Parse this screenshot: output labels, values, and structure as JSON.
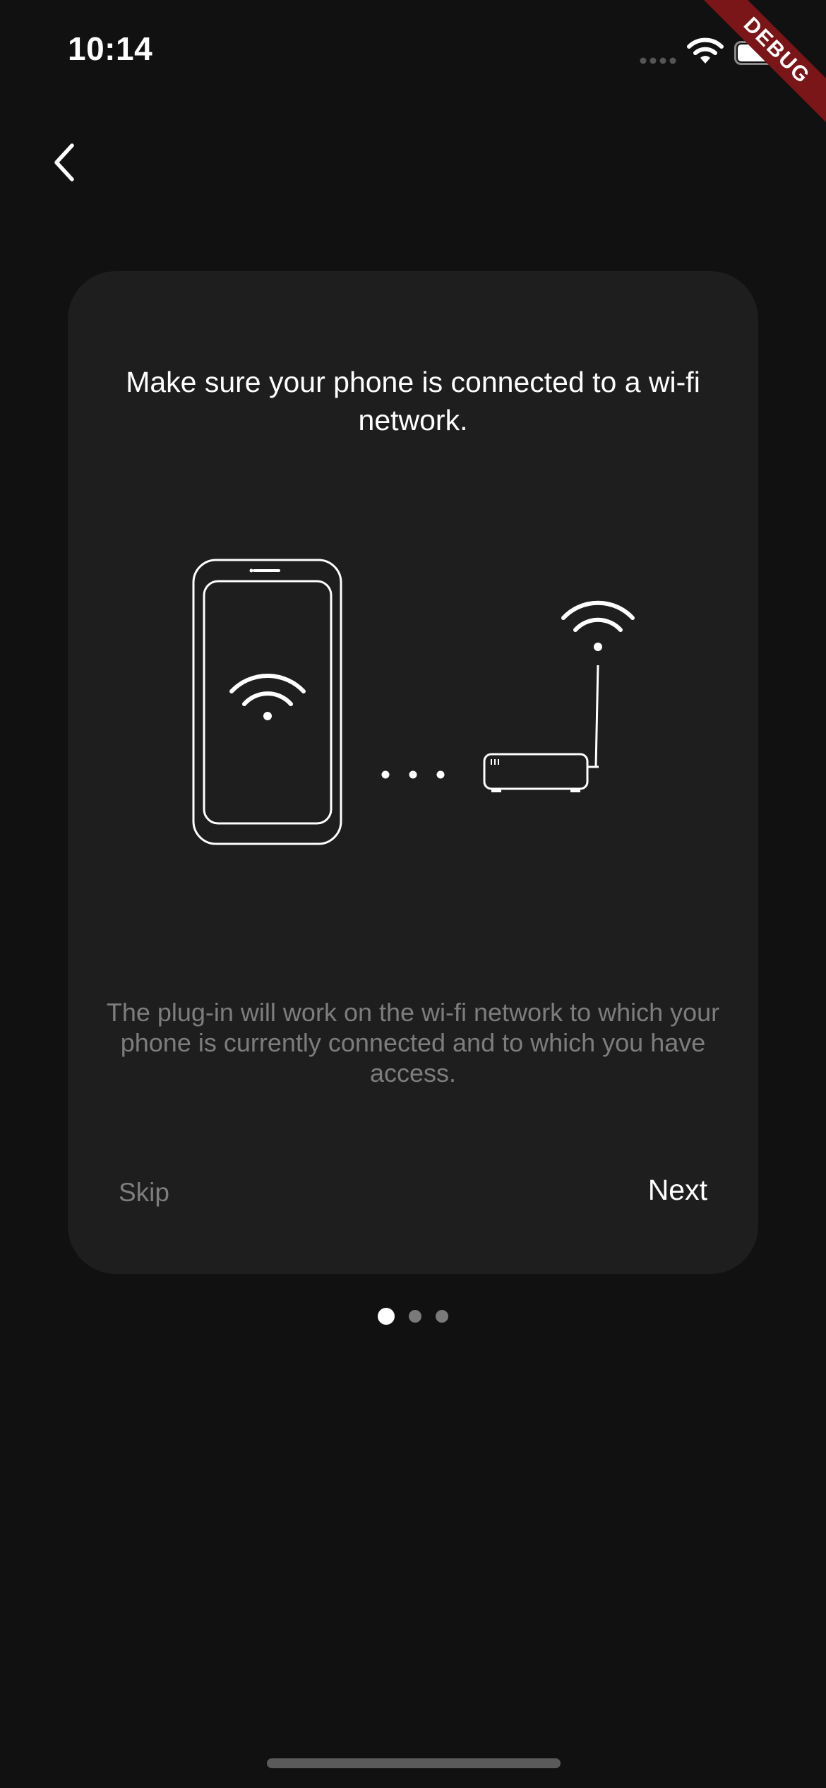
{
  "status_bar": {
    "time": "10:14"
  },
  "debug_banner": {
    "label": "DEBUG"
  },
  "onboarding": {
    "title": "Make sure your phone is connected to a wi-fi network.",
    "description": "The plug-in will work on the wi-fi network to which your phone is currently connected and to which you have access.",
    "skip_label": "Skip",
    "next_label": "Next",
    "total_pages": 3,
    "current_page": 1
  },
  "icons": {
    "back": "chevron-left-icon",
    "phone": "smartphone-icon",
    "wifi": "wifi-icon",
    "router": "router-icon"
  },
  "colors": {
    "background": "#111111",
    "card": "#1e1e1e",
    "primary_text": "#ffffff",
    "secondary_text": "#7d7d7d",
    "debug_ribbon": "#7a1518"
  }
}
